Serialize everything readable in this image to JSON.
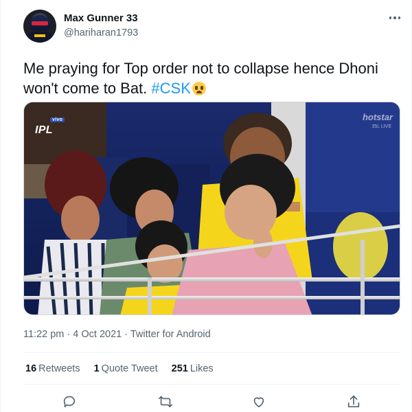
{
  "user": {
    "display_name": "Max Gunner 33",
    "handle": "@hariharan1793"
  },
  "tweet": {
    "text": "Me praying for Top order not to collapse hence Dhoni won't come to Bat. ",
    "hashtag": "#CSK"
  },
  "media": {
    "badge_sponsor": "vivo",
    "badge_logo": "IPL",
    "broadcaster": "hotstar",
    "live_label": "35L LIVE"
  },
  "meta": {
    "time": "11:22 pm",
    "date": "4 Oct 2021",
    "source": "Twitter for Android",
    "full": "11:22 pm · 4 Oct 2021 · Twitter for Android"
  },
  "stats": {
    "retweets_count": "16",
    "retweets_label": "Retweets",
    "quotes_count": "1",
    "quotes_label": "Quote Tweet",
    "likes_count": "251",
    "likes_label": "Likes"
  },
  "icons": {
    "reply": "reply-icon",
    "retweet": "retweet-icon",
    "like": "like-icon",
    "share": "share-icon",
    "more": "more-icon",
    "emoji": "fearful-face-emoji"
  },
  "colors": {
    "accent": "#1d9bf0",
    "text_primary": "#0f1419",
    "text_secondary": "#536471",
    "divider": "#eff3f4"
  }
}
